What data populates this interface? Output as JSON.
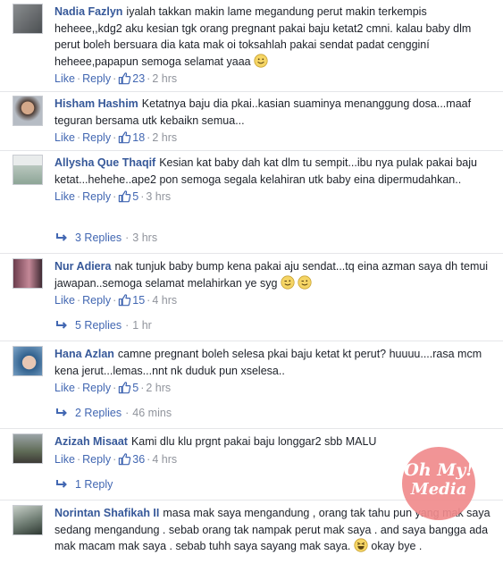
{
  "labels": {
    "like": "Like",
    "reply": "Reply"
  },
  "comments": [
    {
      "name": "Nadia Fazlyn",
      "text": "iyalah takkan makin lame megandung perut makin terkempis heheee,,kdg2 aku kesian tgk orang pregnant pakai baju ketat2 cmni. kalau baby dlm perut boleh bersuara dia kata mak oi toksahlah pakai sendat padat cengginí heheee,papapun semoga selamat yaaa",
      "likes": "23",
      "time": "2 hrs"
    },
    {
      "name": "Hisham Hashim",
      "text": "Ketatnya baju dia pkai..kasian suaminya menanggung dosa...maaf teguran bersama utk kebaikn semua...",
      "likes": "18",
      "time": "2 hrs"
    },
    {
      "name": "Allysha Que Thaqif",
      "text": "Kesian kat baby dah kat dlm tu sempit...ibu nya pulak pakai baju ketat...hehehe..ape2 pon semoga segala kelahiran utk baby eina dipermudahkan..",
      "likes": "5",
      "time": "3 hrs",
      "replies": "3 Replies",
      "replies_time": "3 hrs"
    },
    {
      "name": "Nur Adiera",
      "text": "nak tunjuk baby bump kena pakai aju sendat...tq eina azman saya dh temui jawapan..semoga selamat melahirkan ye syg",
      "likes": "15",
      "time": "4 hrs",
      "replies": "5 Replies",
      "replies_time": "1 hr"
    },
    {
      "name": "Hana Azlan",
      "text": "camne pregnant boleh selesa pkai baju ketat kt perut? huuuu....rasa mcm kena jerut...lemas...nnt nk duduk pun xselesa..",
      "likes": "5",
      "time": "2 hrs",
      "replies": "2 Replies",
      "replies_time": "46 mins"
    },
    {
      "name": "Azizah Misaat",
      "text": "Kami dlu klu prgnt pakai baju longgar2 sbb MALU",
      "likes": "36",
      "time": "4 hrs",
      "replies": "1 Reply"
    },
    {
      "name": "Norintan Shafikah II",
      "text": "masa mak saya mengandung , orang tak tahu pun yang mak saya sedang mengandung . sebab orang tak nampak perut mak saya . and saya bangga ada mak macam mak saya . sebab tuhh saya sayang mak saya.",
      "text_end": "okay bye ."
    }
  ],
  "watermark": {
    "line1": "Oh My!",
    "line2": "Media"
  },
  "colors": {
    "link": "#365899",
    "action": "#4267b2",
    "muted": "#90949c",
    "text": "#1d2129",
    "divider": "#e5e6e9"
  }
}
